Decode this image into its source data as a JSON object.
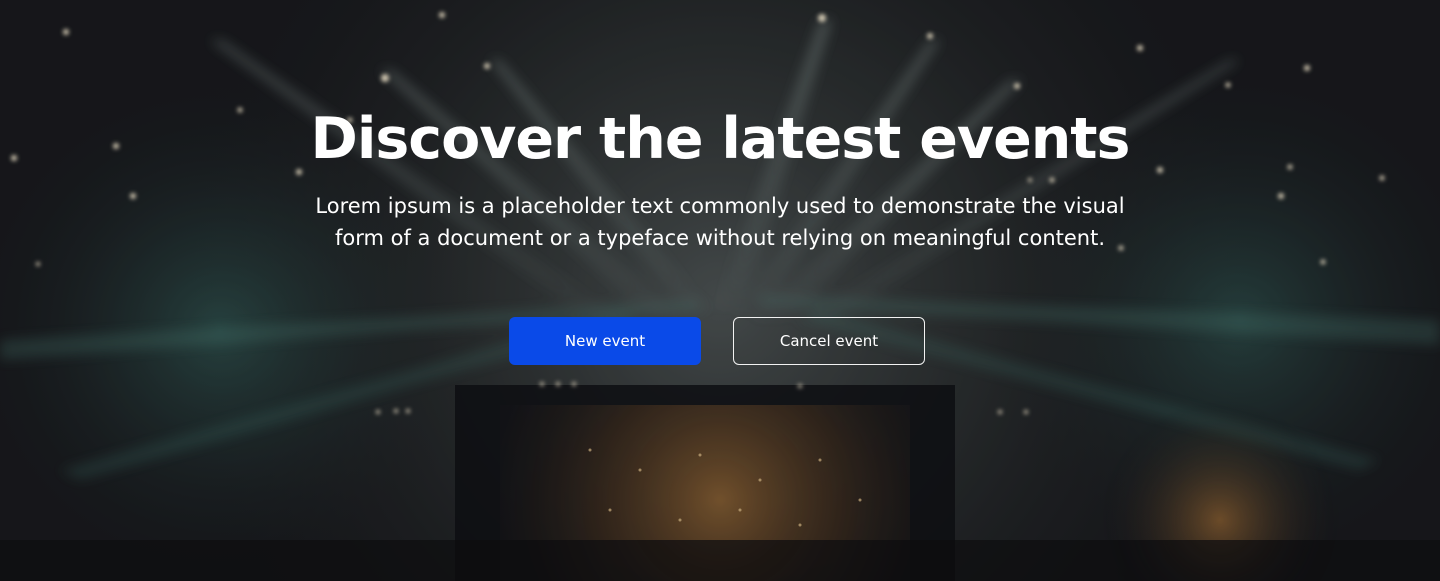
{
  "hero": {
    "background": "concert-stage-photo",
    "title": "Discover the latest events",
    "subtitle": "Lorem ipsum is a placeholder text commonly used to demonstrate the visual form of a document or a typeface without relying on meaningful content.",
    "primary_button": {
      "label": "New event",
      "color": "#0a4ae8"
    },
    "secondary_button": {
      "label": "Cancel event",
      "border_color": "#f2f2f2"
    }
  }
}
